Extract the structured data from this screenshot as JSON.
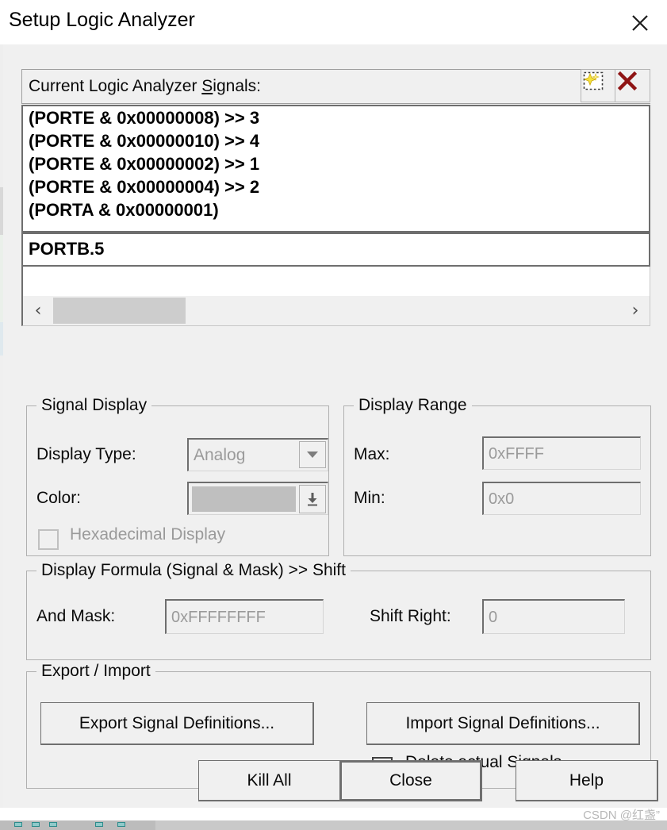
{
  "window": {
    "title": "Setup Logic Analyzer",
    "close_icon": "close-icon"
  },
  "signals_panel": {
    "header_label_prefix": "Current Logic Analyzer ",
    "header_label_accesskey": "S",
    "header_label_suffix": "ignals:",
    "toolbar": {
      "new_signal_icon": "new-signal-icon",
      "delete_signal_icon": "delete-signal-icon"
    },
    "signals": [
      "(PORTE & 0x00000008) >> 3",
      "(PORTE & 0x00000010) >> 4",
      "(PORTE & 0x00000002) >> 1",
      "(PORTE & 0x00000004) >> 2",
      "(PORTA & 0x00000001)"
    ],
    "edit_value": "PORTB.5",
    "scrollbar": {
      "left_arrow": "‹",
      "right_arrow": "›"
    }
  },
  "signal_display": {
    "title": "Signal Display",
    "display_type_label": "Display Type:",
    "display_type_value": "Analog",
    "color_label": "Color:",
    "color_value": "#bfbfbf",
    "hex_display_label": "Hexadecimal Display",
    "hex_display_checked": false
  },
  "display_range": {
    "title": "Display Range",
    "max_label": "Max:",
    "max_value": "0xFFFF",
    "min_label": "Min:",
    "min_value": "0x0"
  },
  "display_formula": {
    "title": "Display Formula (Signal & Mask) >> Shift",
    "and_mask_label": "And Mask:",
    "and_mask_value": "0xFFFFFFFF",
    "shift_right_label": "Shift Right:",
    "shift_right_value": "0"
  },
  "export_import": {
    "title": "Export / Import",
    "export_label": "Export Signal Definitions...",
    "import_label": "Import Signal Definitions...",
    "delete_actual_label": "Delete actual Signals",
    "delete_actual_checked": false
  },
  "footer": {
    "kill_all_label": "Kill All",
    "close_label": "Close",
    "help_label": "Help"
  },
  "watermark": {
    "text": "CSDN @红盏”"
  }
}
